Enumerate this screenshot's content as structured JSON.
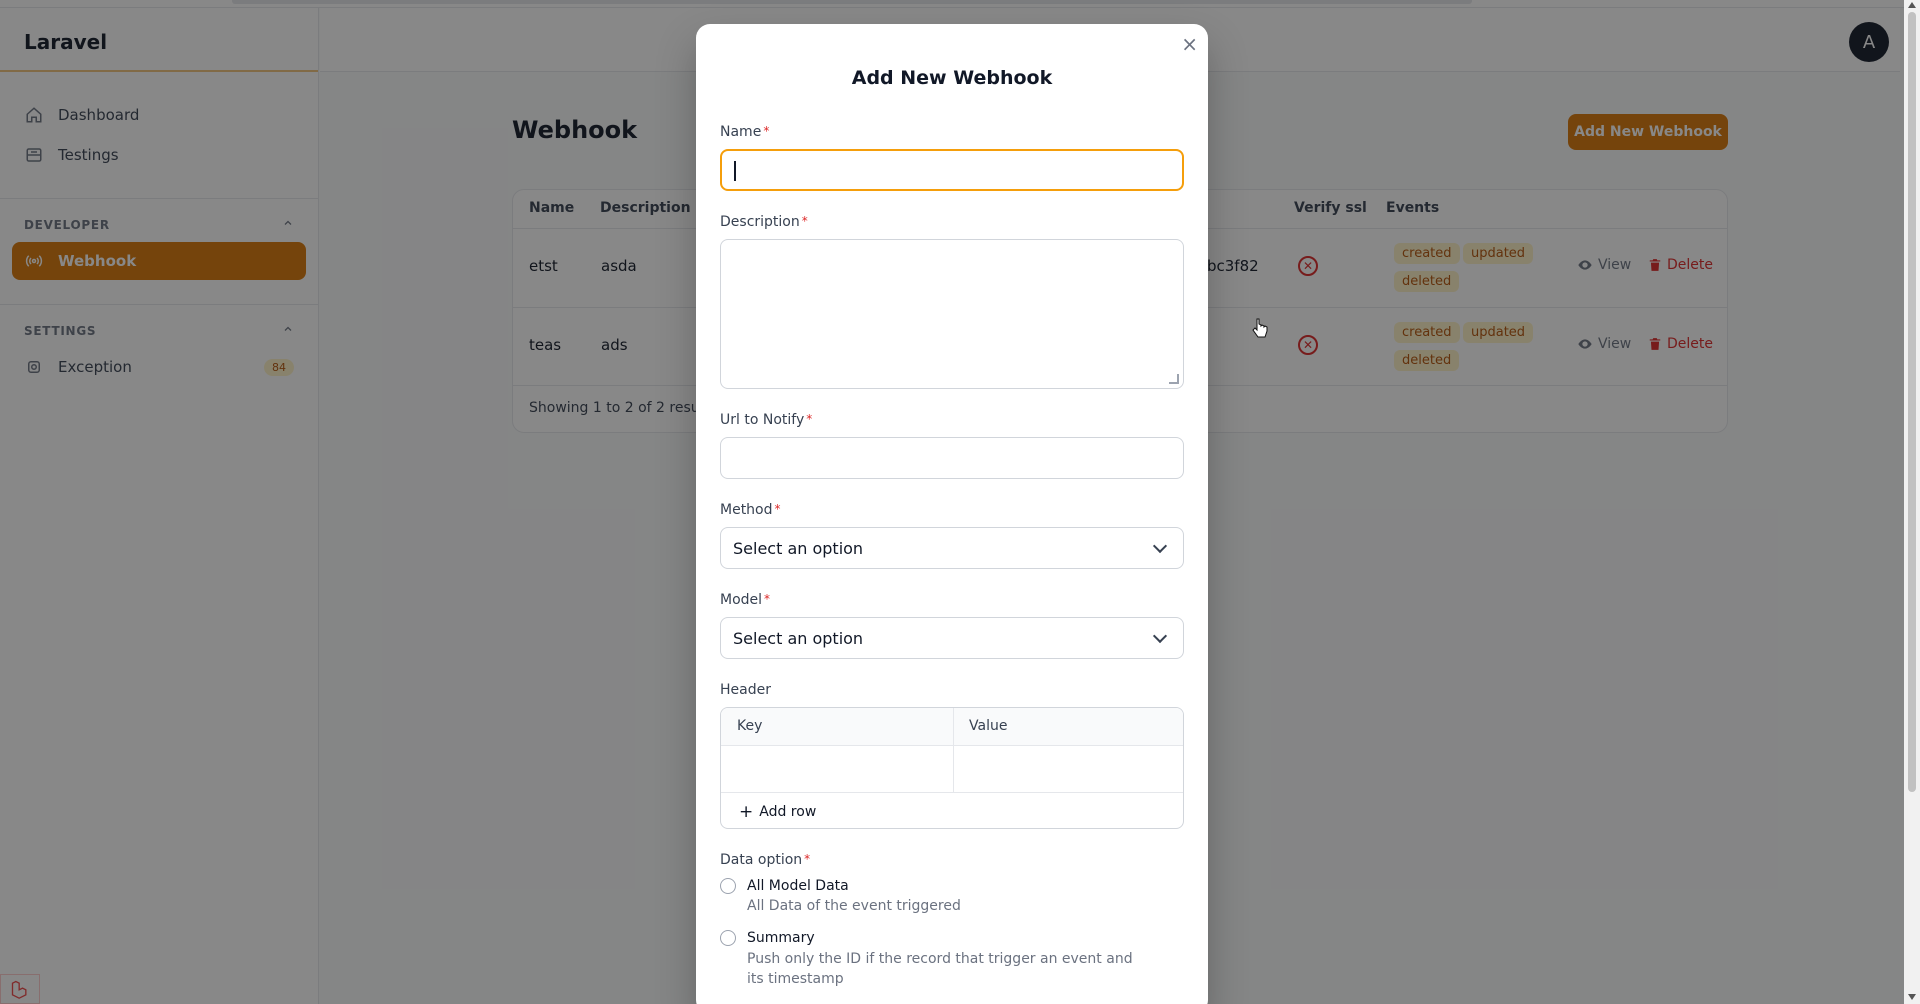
{
  "app": {
    "brand": "Laravel",
    "avatar_initial": "A"
  },
  "sidebar": {
    "items": [
      {
        "label": "Dashboard",
        "icon": "home-icon"
      },
      {
        "label": "Testings",
        "icon": "inbox-icon"
      }
    ],
    "groups": [
      {
        "title": "DEVELOPER",
        "items": [
          {
            "label": "Webhook",
            "icon": "signal-icon",
            "active": true
          }
        ]
      },
      {
        "title": "SETTINGS",
        "items": [
          {
            "label": "Exception",
            "icon": "cog-icon",
            "count": "84"
          }
        ]
      }
    ]
  },
  "page": {
    "title": "Webhook",
    "add_button": "Add New Webhook",
    "table": {
      "columns": [
        "Name",
        "Description",
        "Verify ssl",
        "Events"
      ],
      "rows": [
        {
          "name": "etst",
          "description": "asda",
          "partial": "bc3f82",
          "events": [
            "created",
            "updated",
            "deleted"
          ],
          "view": "View",
          "delete": "Delete"
        },
        {
          "name": "teas",
          "description": "ads",
          "events": [
            "created",
            "updated",
            "deleted"
          ],
          "view": "View",
          "delete": "Delete"
        }
      ],
      "footer": "Showing 1 to 2 of 2 results"
    }
  },
  "modal": {
    "title": "Add New Webhook",
    "close": "×",
    "fields": {
      "name": {
        "label": "Name",
        "value": ""
      },
      "description": {
        "label": "Description",
        "value": ""
      },
      "url": {
        "label": "Url to Notify",
        "value": ""
      },
      "method": {
        "label": "Method",
        "value": "Select an option"
      },
      "model": {
        "label": "Model",
        "value": "Select an option"
      }
    },
    "header": {
      "label": "Header",
      "columns": [
        "Key",
        "Value"
      ],
      "add_row": "Add row"
    },
    "data_option": {
      "label": "Data option",
      "options": [
        {
          "title": "All Model Data",
          "desc": "All Data of the event triggered"
        },
        {
          "title": "Summary",
          "desc": "Push only the ID if the record that trigger an event and its timestamp"
        }
      ]
    }
  },
  "colors": {
    "accent": "#d97706",
    "danger": "#dc2626",
    "focus": "#f59e0b"
  }
}
